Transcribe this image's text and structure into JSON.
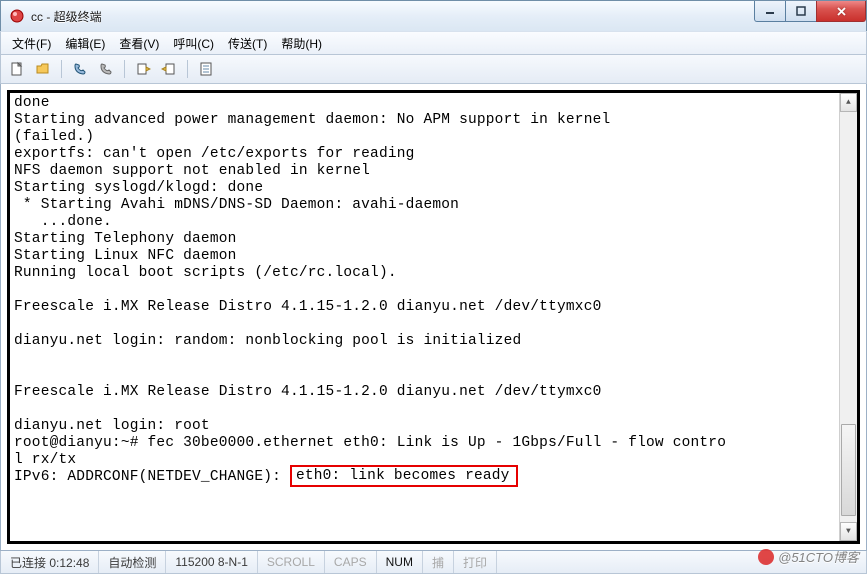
{
  "window": {
    "title": "cc - 超级终端",
    "buttons": {
      "minimize": "min",
      "maximize": "max",
      "close": "close"
    }
  },
  "menu": {
    "file": "文件(F)",
    "edit": "编辑(E)",
    "view": "查看(V)",
    "call": "呼叫(C)",
    "transfer": "传送(T)",
    "help": "帮助(H)"
  },
  "toolbar_icons": {
    "new": "new-doc-icon",
    "open": "open-folder-icon",
    "connect": "phone-connect-icon",
    "disconnect": "phone-disconnect-icon",
    "send": "send-file-icon",
    "receive": "receive-file-icon",
    "properties": "properties-icon"
  },
  "terminal": {
    "lines": [
      "done",
      "Starting advanced power management daemon: No APM support in kernel",
      "(failed.)",
      "exportfs: can't open /etc/exports for reading",
      "NFS daemon support not enabled in kernel",
      "Starting syslogd/klogd: done",
      " * Starting Avahi mDNS/DNS-SD Daemon: avahi-daemon",
      "   ...done.",
      "Starting Telephony daemon",
      "Starting Linux NFC daemon",
      "Running local boot scripts (/etc/rc.local).",
      "",
      "Freescale i.MX Release Distro 4.1.15-1.2.0 dianyu.net /dev/ttymxc0",
      "",
      "dianyu.net login: random: nonblocking pool is initialized",
      "",
      "",
      "Freescale i.MX Release Distro 4.1.15-1.2.0 dianyu.net /dev/ttymxc0",
      "",
      "dianyu.net login: root",
      "root@dianyu:~# fec 30be0000.ethernet eth0: Link is Up - 1Gbps/Full - flow contro",
      "l rx/tx"
    ],
    "lastline_prefix": "IPv6: ADDRCONF(NETDEV_CHANGE): ",
    "lastline_highlight": "eth0: link becomes ready"
  },
  "statusbar": {
    "connected": "已连接 0:12:48",
    "detect": "自动检测",
    "port": "115200 8-N-1",
    "scroll": "SCROLL",
    "caps": "CAPS",
    "num": "NUM",
    "capture": "捕",
    "print": "打印"
  },
  "watermark": "@51CTO博客"
}
